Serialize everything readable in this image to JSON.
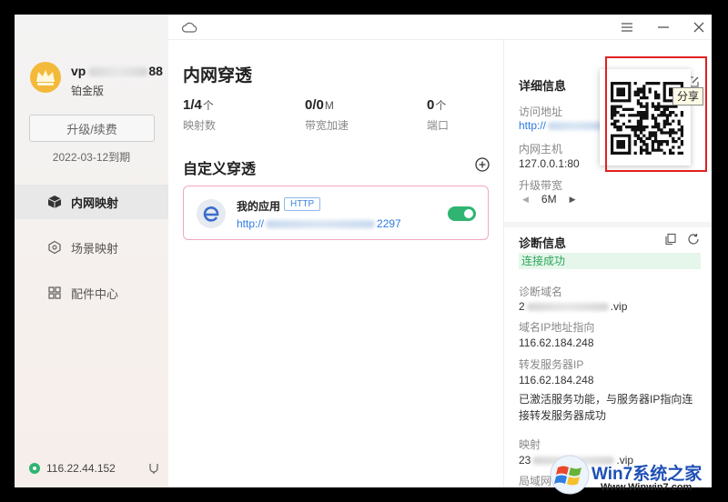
{
  "user": {
    "name_visible_start": "vp",
    "name_visible_end": "88",
    "tier": "铂金版",
    "upgrade_label": "升级/续费",
    "expire": "2022-03-12到期"
  },
  "nav": {
    "items": [
      {
        "label": "内网映射",
        "icon": "cube-icon",
        "active": true
      },
      {
        "label": "场景映射",
        "icon": "hexagon-icon",
        "active": false
      },
      {
        "label": "配件中心",
        "icon": "grid-icon",
        "active": false
      }
    ]
  },
  "status": {
    "ip": "116.22.44.152"
  },
  "main": {
    "title": "内网穿透",
    "stats": [
      {
        "value": "1/4",
        "unit": "个",
        "label": "映射数"
      },
      {
        "value": "0/0",
        "unit": "M",
        "label": "带宽加速"
      },
      {
        "value": "0",
        "unit": "个",
        "label": "端口"
      }
    ],
    "custom_title": "自定义穿透",
    "app": {
      "name": "我的应用",
      "protocol": "HTTP",
      "url_start": "http://",
      "url_end": "2297",
      "enabled": true
    }
  },
  "details": {
    "title": "详细信息",
    "access_label": "访问地址",
    "access_url_start": "http://",
    "access_url_end": "h7",
    "host_label": "内网主机",
    "host_value": "127.0.0.1:80",
    "bandwidth_label": "升级带宽",
    "bandwidth_value": "6M",
    "share_tooltip": "分享"
  },
  "diagnosis": {
    "title": "诊断信息",
    "status": "连接成功",
    "domain_label": "诊断域名",
    "domain_start": "2",
    "domain_end": ".vip",
    "ip_label": "域名IP地址指向",
    "ip_value": "116.62.184.248",
    "forward_label": "转发服务器IP",
    "forward_value": "116.62.184.248",
    "note": "已激活服务功能，与服务器IP指向连接转发服务器成功",
    "mapping_label": "映射",
    "mapping_start": "23",
    "mapping_end": ".vip",
    "lan_label": "局域网"
  },
  "watermark": {
    "title": "Win7系统之家",
    "url": "Www.Winwin7.com"
  },
  "colors": {
    "accent_green": "#2fb571",
    "link_blue": "#2d7be0",
    "card_border": "#f2a7bf",
    "highlight_red": "#e02020"
  }
}
